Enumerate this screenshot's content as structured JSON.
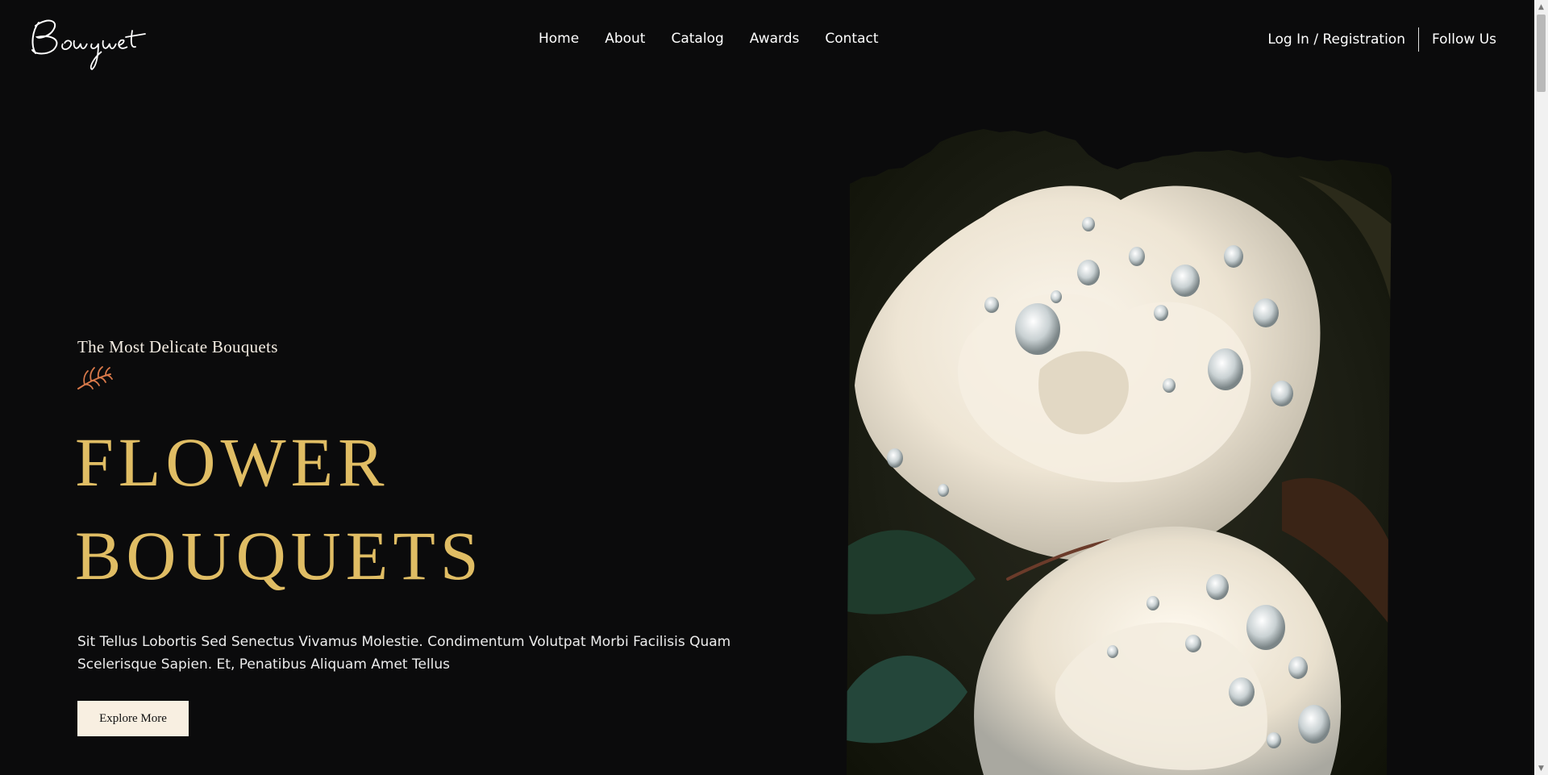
{
  "header": {
    "logo_text": "Bouquet",
    "nav": [
      {
        "label": "Home"
      },
      {
        "label": "About"
      },
      {
        "label": "Catalog"
      },
      {
        "label": "Awards"
      },
      {
        "label": "Contact"
      }
    ],
    "login_label": "Log In / Registration",
    "follow_label": "Follow Us"
  },
  "hero": {
    "eyebrow": "The Most Delicate Bouquets",
    "headline_line1": "FLOWER",
    "headline_line2": "BOUQUETS",
    "description": "Sit Tellus Lobortis Sed Senectus Vivamus Molestie. Condimentum Volutpat Morbi Facilisis Quam Scelerisque Sapien. Et, Penatibus Aliquam Amet Tellus",
    "cta_label": "Explore More",
    "image_icon": "white-rose-photo"
  },
  "colors": {
    "background": "#0b0b0c",
    "accent_gold": "#e0bd64",
    "sprig_orange": "#d9794a",
    "button_bg": "#f8efe1"
  }
}
